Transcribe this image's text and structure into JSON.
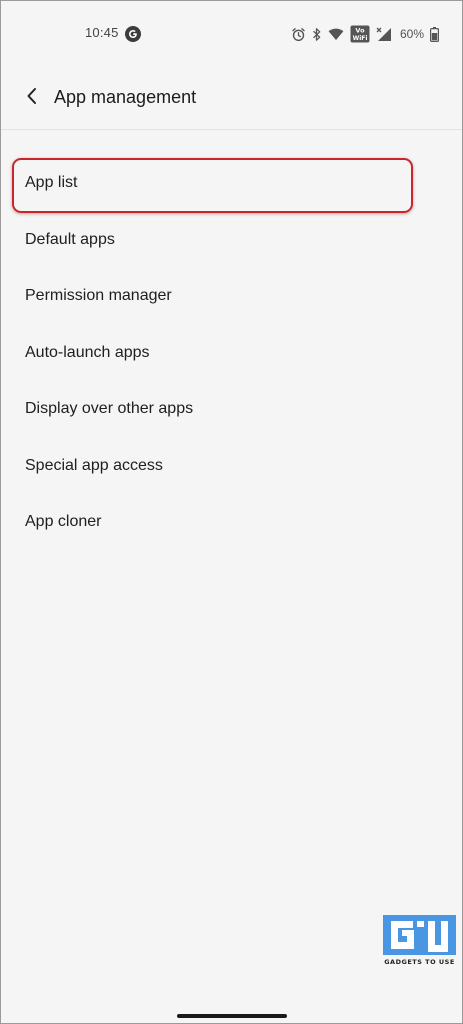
{
  "status_bar": {
    "time": "10:45",
    "battery_percent": "60%",
    "network_badge": "Vo WiFi",
    "icons": [
      "google-g-icon",
      "alarm-icon",
      "bluetooth-icon",
      "wifi-icon",
      "vowifi-icon",
      "signal-icon",
      "battery-icon"
    ]
  },
  "header": {
    "title": "App management",
    "back_icon": "chevron-left-icon"
  },
  "menu": {
    "items": [
      {
        "label": "App list",
        "highlighted": true
      },
      {
        "label": "Default apps"
      },
      {
        "label": "Permission manager"
      },
      {
        "label": "Auto-launch apps"
      },
      {
        "label": "Display over other apps"
      },
      {
        "label": "Special app access"
      },
      {
        "label": "App cloner"
      }
    ]
  },
  "watermark": {
    "text": "GADGETS TO USE"
  },
  "colors": {
    "background": "#f5f5f5",
    "highlight": "#c8262b",
    "watermark_blue": "#3a8ee0"
  }
}
